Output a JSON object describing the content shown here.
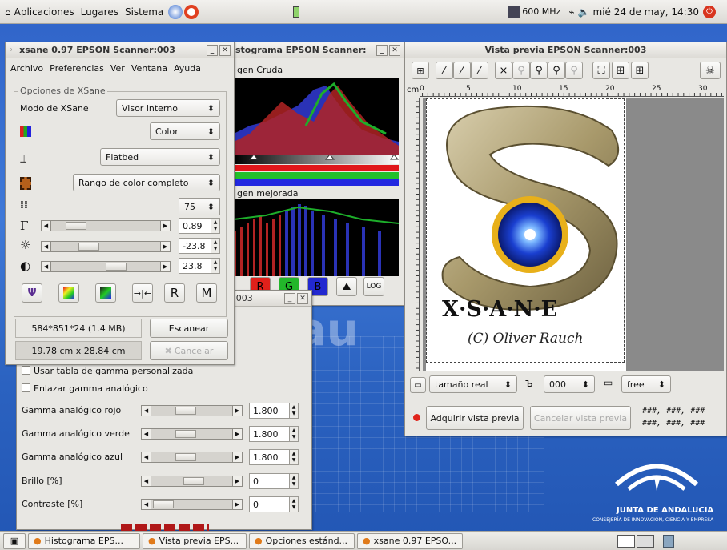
{
  "top_panel": {
    "apps": "Aplicaciones",
    "places": "Lugares",
    "system": "Sistema",
    "cpu": "600 MHz",
    "clock": "mié 24 de may, 14:30"
  },
  "hist_win": {
    "title": "stograma EPSON Scanner:",
    "raw": "gen Cruda",
    "enh": "gen mejorada",
    "log_btn": "LOG",
    "r": "R",
    "g": "G",
    "b": "B"
  },
  "preview_win": {
    "title": "Vista previa EPSON Scanner:003",
    "ruler_unit": "cm",
    "ruler_marks": [
      "0",
      "5",
      "10",
      "15",
      "20",
      "25",
      "30"
    ],
    "size_select": "tamaño real",
    "dpi_select": "000",
    "ratio_select": "free",
    "acquire_button": "Adquirir vista previa",
    "cancel_button": "Cancelar vista previa",
    "coords_1": "###, ###, ###",
    "coords_2": "###, ###, ###",
    "logo_text": "X·S·A·N·E",
    "logo_credit": "(C) Oliver Rauch",
    "colors": {
      "dot": "#e0241b"
    }
  },
  "xsane_win": {
    "title": "xsane 0.97 EPSON Scanner:003",
    "menu": [
      "Archivo",
      "Preferencias",
      "Ver",
      "Ventana",
      "Ayuda"
    ],
    "group_label": "Opciones de XSane",
    "mode_label": "Modo de XSane",
    "mode_value": "Visor interno",
    "color_value": "Color",
    "source_value": "Flatbed",
    "range_value": "Rango de color completo",
    "resolution": "75",
    "gamma": "0.89",
    "brightness": "-23.8",
    "contrast": "23.8",
    "img_size": "584*851*24 (1.4 MB)",
    "scan_button": "Escanear",
    "dimensions": "19.78 cm x 28.84 cm",
    "cancel_button": "Cancelar",
    "tool_r": "R",
    "tool_m": "M"
  },
  "std_win": {
    "title": ":003",
    "use_gamma": "Usar tabla de gamma personalizada",
    "link_gamma": "Enlazar gamma analógico",
    "rows": [
      {
        "label": "Gamma analógico rojo",
        "value": "1.800"
      },
      {
        "label": "Gamma analógico verde",
        "value": "1.800"
      },
      {
        "label": "Gamma analógico azul",
        "value": "1.800"
      },
      {
        "label": "Brillo [%]",
        "value": "0"
      },
      {
        "label": "Contraste [%]",
        "value": "0"
      }
    ]
  },
  "desktop": {
    "brand": "JUNTA DE ANDALUCIA",
    "brand_sub": "CONSEJERÍA DE INNOVACIÓN, CIENCIA Y EMPRESA"
  },
  "taskbar": {
    "items": [
      "Histograma EPS...",
      "Vista previa EPS...",
      "Opciones estánd...",
      "xsane 0.97 EPSO..."
    ]
  }
}
